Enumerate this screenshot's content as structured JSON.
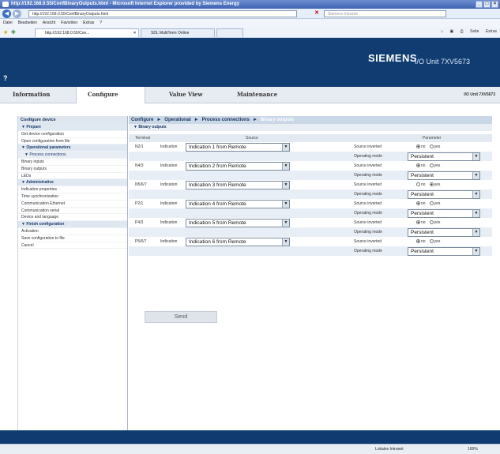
{
  "browser": {
    "title": "http://192.168.0.55/ConfBinaryOutputs.html - Microsoft Internet Explorer provided by Siemens Energy",
    "url": "http://192.168.0.55/ConfBinaryOutputs.html",
    "search_placeholder": "Siemens Intranet",
    "menu": [
      "Datei",
      "Bearbeiten",
      "Ansicht",
      "Favoriten",
      "Extras",
      "?"
    ],
    "tabs": [
      "http://192.168.0.55/Con...",
      "SDL MultiTerm Online"
    ],
    "tools": [
      "Seite",
      "Extras"
    ],
    "status_zone": "Lokales Intranet",
    "zoom": "100%"
  },
  "header": {
    "brand": "SIEMENS",
    "unit": "I/O Unit 7XV5673",
    "help": "?"
  },
  "nav_tabs": [
    "Information",
    "Configure",
    "Value View",
    "Maintenance"
  ],
  "nav_unit": "I/O Unit 7XV5673",
  "sidebar": {
    "title": "Configure device",
    "items": [
      {
        "label": "▼ Prepare",
        "kind": "group"
      },
      {
        "label": "Get device configuration",
        "kind": "item"
      },
      {
        "label": "Open configuration from file",
        "kind": "item"
      },
      {
        "label": "▼ Operational parameters",
        "kind": "group"
      },
      {
        "label": "▼ Process connections",
        "kind": "sub"
      },
      {
        "label": "Binary inputs",
        "kind": "item"
      },
      {
        "label": "Binary outputs",
        "kind": "item"
      },
      {
        "label": "LEDs",
        "kind": "item"
      },
      {
        "label": "▼ Administrative",
        "kind": "group"
      },
      {
        "label": "Indication properties",
        "kind": "item"
      },
      {
        "label": "Time synchronization",
        "kind": "item"
      },
      {
        "label": "Communication Ethernet",
        "kind": "item"
      },
      {
        "label": "Communication serial",
        "kind": "item"
      },
      {
        "label": "Device and language",
        "kind": "item"
      },
      {
        "label": "▼ Finish configuration",
        "kind": "group"
      },
      {
        "label": "Activation",
        "kind": "item"
      },
      {
        "label": "Save configuration to file",
        "kind": "item"
      },
      {
        "label": "Cancel",
        "kind": "item"
      }
    ]
  },
  "main": {
    "breadcrumb": [
      "Configure",
      "Operational",
      "Process connections",
      "Binary outputs"
    ],
    "breadcrumb_sep": "►",
    "section": "▼ Binary outputs",
    "columns": {
      "terminal": "Terminal",
      "source": "Source",
      "parameter": "Parameter"
    },
    "labels": {
      "indication": "Indication",
      "source_inverted": "Source inverted",
      "operating_mode": "Operating mode",
      "no": "no",
      "yes": "yes"
    },
    "outputs": [
      {
        "terminal": "N2/1",
        "source": "Indication 1 from Remote",
        "inverted": "no",
        "mode": "Persistent"
      },
      {
        "terminal": "N4/3",
        "source": "Indication 2 from Remote",
        "inverted": "no",
        "mode": "Persistent"
      },
      {
        "terminal": "N5/6/7",
        "source": "Indication 3 from Remote",
        "inverted": "yes",
        "mode": "Persistent"
      },
      {
        "terminal": "P2/1",
        "source": "Indication 4 from Remote",
        "inverted": "no",
        "mode": "Persistent"
      },
      {
        "terminal": "P4/3",
        "source": "Indication 5 from Remote",
        "inverted": "no",
        "mode": "Persistent"
      },
      {
        "terminal": "P5/6/7",
        "source": "Indication 6 from Remote",
        "inverted": "no",
        "mode": "Persistent"
      }
    ],
    "send_label": "Send"
  }
}
